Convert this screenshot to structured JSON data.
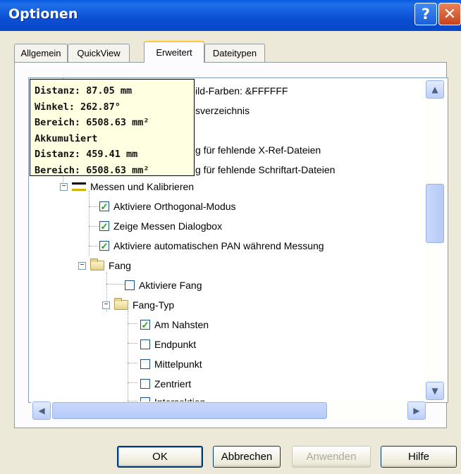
{
  "window": {
    "title": "Optionen",
    "help_glyph": "?",
    "close_glyph": "✕"
  },
  "tabs": [
    {
      "label": "Allgemein"
    },
    {
      "label": "QuickView"
    },
    {
      "label": "Erweitert"
    },
    {
      "label": "Dateitypen"
    }
  ],
  "tree": {
    "partial_items": [
      "ild-Farben: &FFFFFF",
      "sverzeichnis",
      "g für fehlende X-Ref-Dateien",
      "g für fehlende Schriftart-Dateien"
    ],
    "items": [
      {
        "label": "Messen und Kalibrieren",
        "type": "group",
        "expander": "−"
      },
      {
        "label": "Aktiviere Orthogonal-Modus",
        "type": "checkbox",
        "checked": true
      },
      {
        "label": "Zeige Messen Dialogbox",
        "type": "checkbox",
        "checked": true
      },
      {
        "label": "Aktiviere automatischen PAN während Messung",
        "type": "checkbox",
        "checked": true
      },
      {
        "label": "Fang",
        "type": "folder",
        "expander": "−"
      },
      {
        "label": "Aktiviere Fang",
        "type": "checkbox",
        "checked": false
      },
      {
        "label": "Fang-Typ",
        "type": "folder",
        "expander": "−"
      },
      {
        "label": "Am Nahsten",
        "type": "checkbox",
        "checked": true
      },
      {
        "label": "Endpunkt",
        "type": "checkbox",
        "checked": false
      },
      {
        "label": "Mittelpunkt",
        "type": "checkbox",
        "checked": false
      },
      {
        "label": "Zentriert",
        "type": "checkbox",
        "checked": false
      },
      {
        "label": "Intersektion",
        "type": "checkbox",
        "checked": false
      }
    ],
    "check_glyph": "✓"
  },
  "tooltip": {
    "lines": [
      "Distanz: 87.05 mm",
      "Winkel: 262.87°",
      "Bereich: 6508.63 mm²",
      "Akkumuliert",
      "Distanz: 459.41 mm",
      "Bereich: 6508.63 mm²"
    ]
  },
  "scrollbars": {
    "up": "▲",
    "down": "▼",
    "left": "◀",
    "right": "▶",
    "thumb_grip": "≡",
    "vertical_position": 0.35,
    "horizontal_position": 0.0
  },
  "buttons": {
    "ok": "OK",
    "cancel": "Abbrechen",
    "apply": "Anwenden",
    "help": "Hilfe"
  },
  "colors": {
    "titlebar": "#0a5ce0",
    "tooltip_bg": "#ffffe1",
    "dialog_bg": "#ece9d8",
    "active_tab_accent": "#ffc83c"
  }
}
